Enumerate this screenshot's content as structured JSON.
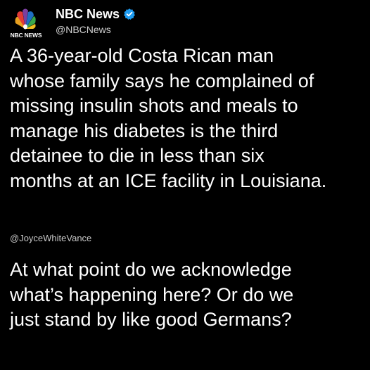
{
  "account": {
    "display_name": "NBC News",
    "handle": "@NBCNews",
    "logo_text": "NBC NEWS",
    "logo_icon": "peacock-logo-icon",
    "verified_icon": "verified-badge-icon",
    "verified_color": "#1d9bf0"
  },
  "post": {
    "lines": [
      "A 36-year-old Costa Rican man",
      "whose family says he complained of",
      "missing insulin shots and meals to",
      "manage his diabetes is the third",
      "detainee to die in less than six",
      "months at an ICE facility in Louisiana."
    ]
  },
  "commentary": {
    "handle": "@JoyceWhiteVance",
    "lines": [
      "At what point do we acknowledge",
      "what’s happening here? Or do we",
      "just stand by like good Germans?"
    ]
  },
  "colors": {
    "background": "#000000",
    "text": "#ffffff",
    "secondary_text": "#c8c8c8"
  }
}
